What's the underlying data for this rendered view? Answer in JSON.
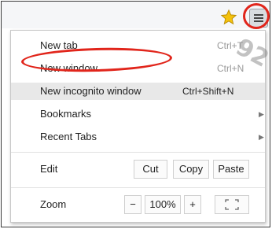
{
  "toolbar": {
    "star_icon": "star-icon",
    "menu_icon": "hamburger-menu-icon",
    "star_color": "#f4c20d"
  },
  "menu": {
    "items": [
      {
        "label": "New tab",
        "shortcut": "Ctrl+T"
      },
      {
        "label": "New window",
        "shortcut": "Ctrl+N"
      },
      {
        "label": "New incognito window",
        "shortcut": "Ctrl+Shift+N"
      },
      {
        "label": "Bookmarks",
        "submenu": true
      },
      {
        "label": "Recent Tabs",
        "submenu": true
      }
    ],
    "edit": {
      "label": "Edit",
      "cut": "Cut",
      "copy": "Copy",
      "paste": "Paste"
    },
    "zoom": {
      "label": "Zoom",
      "minus": "−",
      "level": "100%",
      "plus": "+"
    }
  },
  "highlight_color": "#e1251b",
  "watermark": "92"
}
